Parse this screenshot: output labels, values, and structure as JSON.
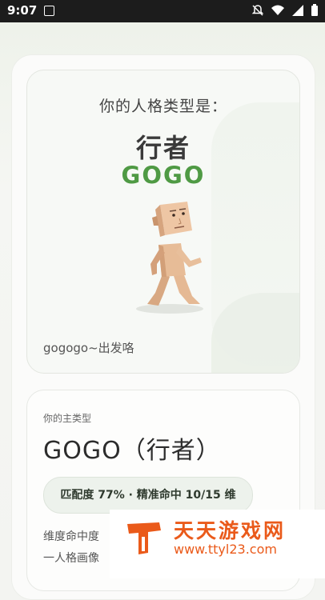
{
  "status": {
    "time": "9:07"
  },
  "result": {
    "subtitle": "你的人格类型是：",
    "type_cn": "行者",
    "type_en": "GOGO",
    "caption": "gogogo~出发咯"
  },
  "info": {
    "label": "你的主类型",
    "type_full": "GOGO（行者）",
    "match": "匹配度 77% · 精准命中 10/15 维",
    "desc_line1": "维度命中度",
    "desc_line2": "一人格画像"
  },
  "watermark": {
    "title": "天天游戏网",
    "url": "www.ttyl23.com"
  },
  "colors": {
    "accent_green": "#4f9a44",
    "watermark_orange": "#ea5a1a"
  }
}
